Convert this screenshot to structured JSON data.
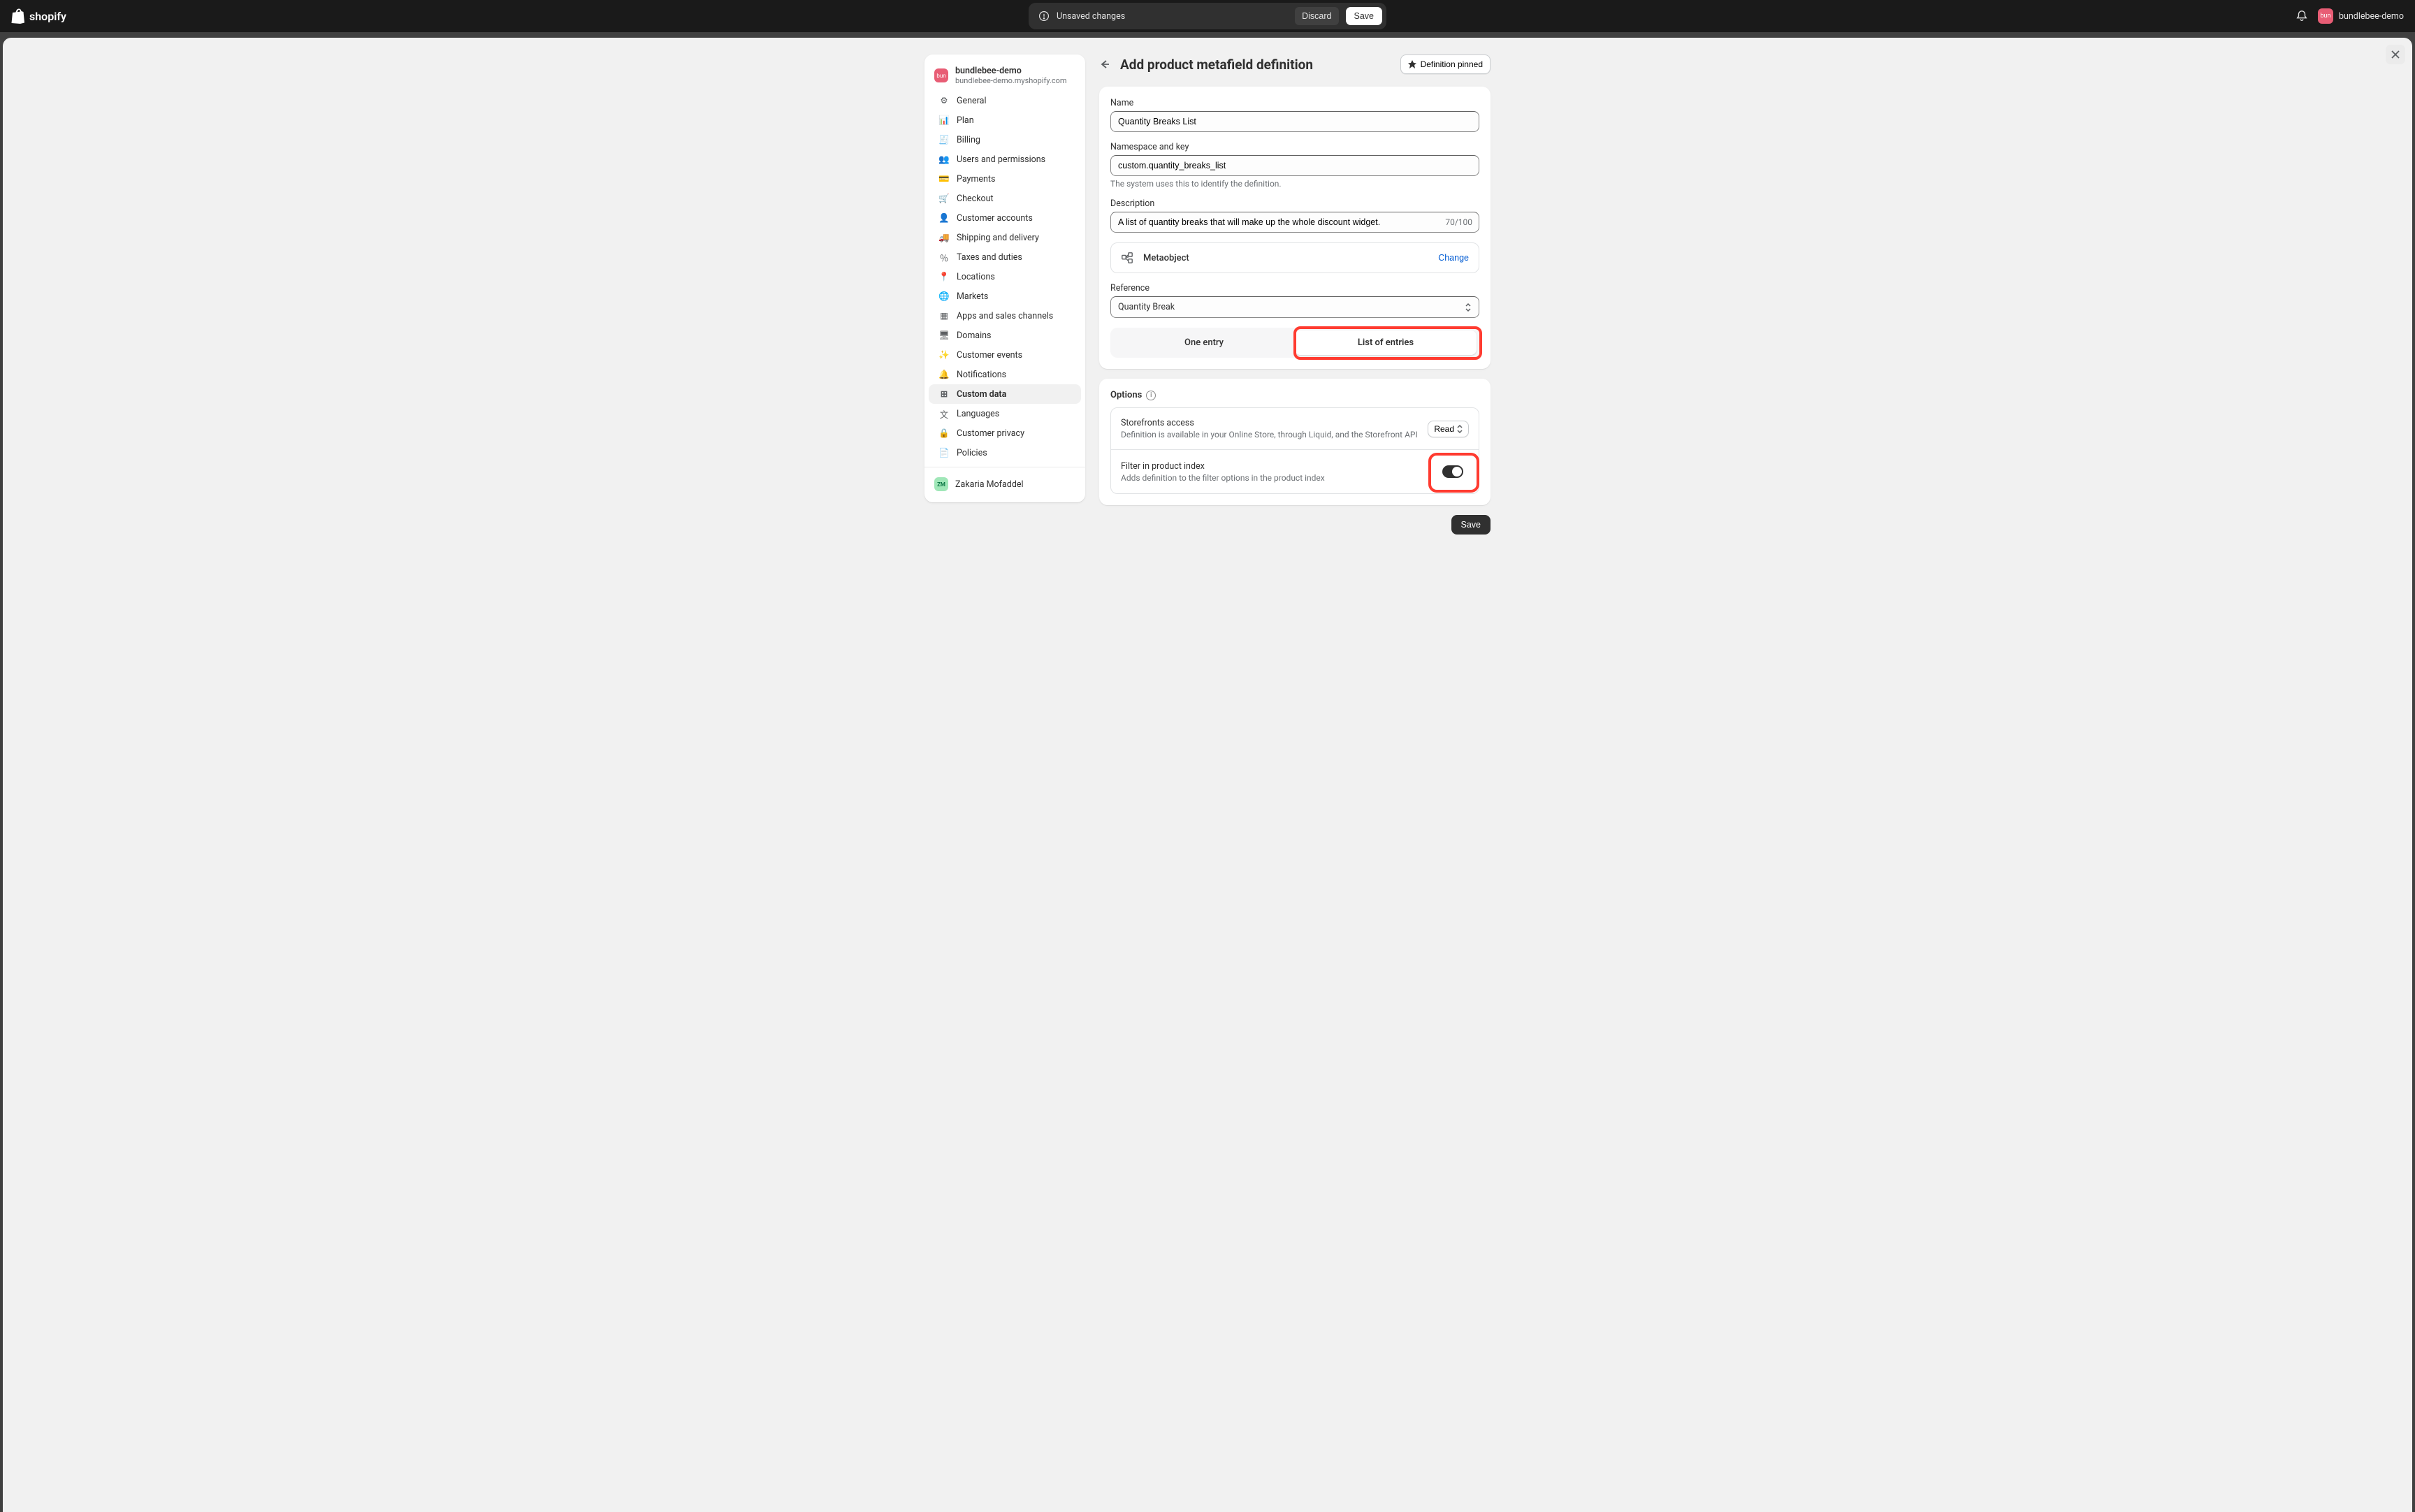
{
  "topbar": {
    "unsaved_label": "Unsaved changes",
    "discard_label": "Discard",
    "save_label": "Save",
    "store_name": "bundlebee-demo",
    "avatar_text": "bun"
  },
  "sidebar": {
    "store_name": "bundlebee-demo",
    "store_url": "bundlebee-demo.myshopify.com",
    "avatar_text": "bun",
    "items": [
      {
        "label": "General"
      },
      {
        "label": "Plan"
      },
      {
        "label": "Billing"
      },
      {
        "label": "Users and permissions"
      },
      {
        "label": "Payments"
      },
      {
        "label": "Checkout"
      },
      {
        "label": "Customer accounts"
      },
      {
        "label": "Shipping and delivery"
      },
      {
        "label": "Taxes and duties"
      },
      {
        "label": "Locations"
      },
      {
        "label": "Markets"
      },
      {
        "label": "Apps and sales channels"
      },
      {
        "label": "Domains"
      },
      {
        "label": "Customer events"
      },
      {
        "label": "Notifications"
      },
      {
        "label": "Custom data"
      },
      {
        "label": "Languages"
      },
      {
        "label": "Customer privacy"
      },
      {
        "label": "Policies"
      }
    ],
    "active_index": 15,
    "user_name": "Zakaria Mofaddel",
    "user_initials": "ZM"
  },
  "page": {
    "title": "Add product metafield definition",
    "pin_label": "Definition pinned"
  },
  "form": {
    "name_label": "Name",
    "name_value": "Quantity Breaks List",
    "namespace_label": "Namespace and key",
    "namespace_value": "custom.quantity_breaks_list",
    "namespace_help": "The system uses this to identify the definition.",
    "description_label": "Description",
    "description_value": "A list of quantity breaks that will make up the whole discount widget.",
    "description_count": "70/100",
    "type_label": "Metaobject",
    "change_label": "Change",
    "reference_label": "Reference",
    "reference_value": "Quantity Break",
    "seg_one": "One entry",
    "seg_list": "List of entries"
  },
  "options": {
    "title": "Options",
    "storefront_title": "Storefronts access",
    "storefront_sub": "Definition is available in your Online Store, through Liquid, and the Storefront API",
    "read_label": "Read",
    "filter_title": "Filter in product index",
    "filter_sub": "Adds definition to the filter options in the product index"
  },
  "footer": {
    "save_label": "Save"
  }
}
